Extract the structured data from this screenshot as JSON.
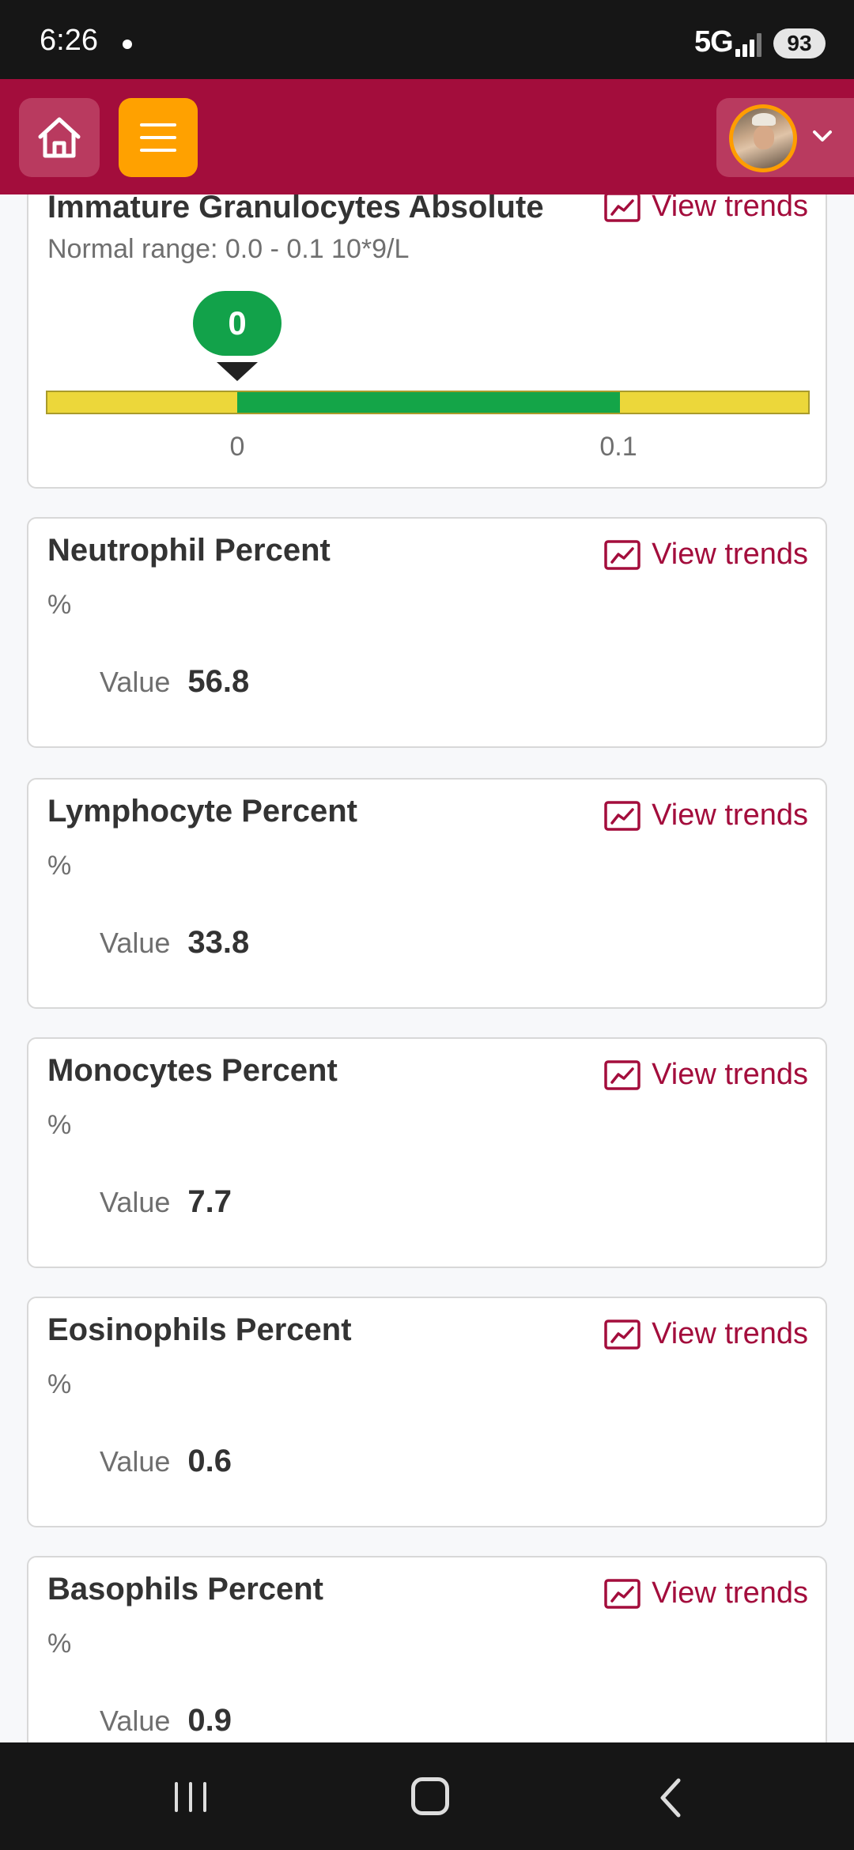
{
  "status_bar": {
    "time": "6:26",
    "network": "5G",
    "battery": "93"
  },
  "header": {
    "home_icon": "home-icon",
    "menu_icon": "hamburger-menu-icon",
    "avatar_icon": "user-avatar",
    "account_chevron_icon": "chevron-down-icon"
  },
  "colors": {
    "brand": "#a30d3c",
    "menu_accent": "#ffa100",
    "in_range": "#12a24a",
    "out_of_range": "#ecd73a"
  },
  "trend_label": "View trends",
  "value_label": "Value",
  "range_card": {
    "title": "Immature Granulocytes Absolute",
    "normal_range": "Normal range: 0.0 - 0.1 10*9/L",
    "value": "0",
    "tick_low": "0",
    "tick_high": "0.1"
  },
  "results": [
    {
      "title": "Neutrophil Percent",
      "unit": "%",
      "value": "56.8"
    },
    {
      "title": "Lymphocyte Percent",
      "unit": "%",
      "value": "33.8"
    },
    {
      "title": "Monocytes Percent",
      "unit": "%",
      "value": "7.7"
    },
    {
      "title": "Eosinophils Percent",
      "unit": "%",
      "value": "0.6"
    },
    {
      "title": "Basophils Percent",
      "unit": "%",
      "value": "0.9"
    }
  ]
}
